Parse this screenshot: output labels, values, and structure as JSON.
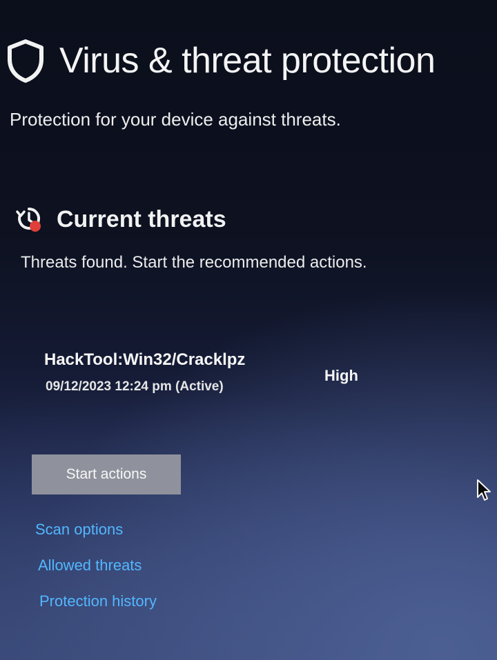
{
  "header": {
    "title": "Virus & threat protection",
    "subtitle": "Protection for your device against threats.",
    "icon": "shield-icon"
  },
  "current_threats": {
    "title": "Current threats",
    "description": "Threats found. Start the recommended actions.",
    "icon": "threat-alert-icon",
    "threats": [
      {
        "name": "HackTool:Win32/Cracklpz",
        "date": "09/12/2023 12:24 pm (Active)",
        "severity": "High"
      }
    ],
    "start_actions_label": "Start actions"
  },
  "links": {
    "scan_options": "Scan options",
    "allowed_threats": "Allowed threats",
    "protection_history": "Protection history"
  },
  "colors": {
    "link": "#52b7ff",
    "button": "#8f929c",
    "alert": "#e0403a"
  }
}
